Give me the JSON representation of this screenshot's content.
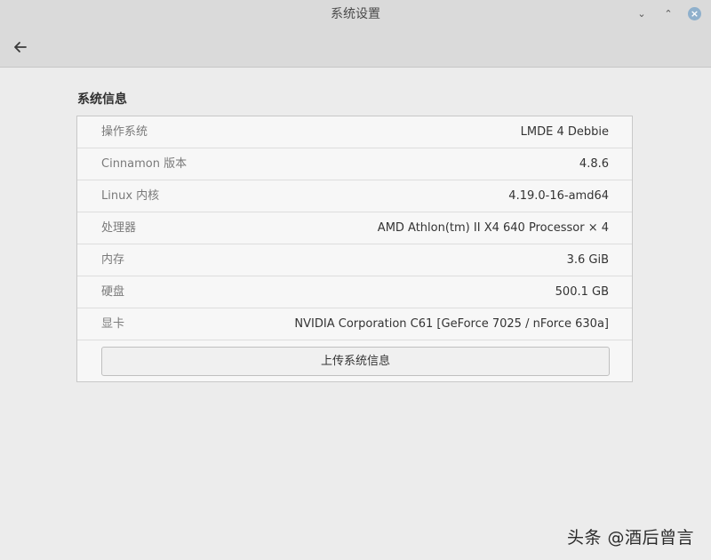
{
  "window": {
    "title": "系统设置",
    "minimize_glyph": "⌄",
    "maximize_glyph": "⌃",
    "close_glyph": "×"
  },
  "toolbar": {
    "back_icon": "back-arrow-icon"
  },
  "section": {
    "title": "系统信息"
  },
  "info": {
    "rows": [
      {
        "label": "操作系统",
        "value": "LMDE 4 Debbie"
      },
      {
        "label": "Cinnamon 版本",
        "value": "4.8.6"
      },
      {
        "label": "Linux 内核",
        "value": "4.19.0-16-amd64"
      },
      {
        "label": "处理器",
        "value": "AMD Athlon(tm) II X4 640 Processor × 4"
      },
      {
        "label": "内存",
        "value": "3.6 GiB"
      },
      {
        "label": "硬盘",
        "value": "500.1 GB"
      },
      {
        "label": "显卡",
        "value": "NVIDIA Corporation C61 [GeForce 7025 / nForce 630a]"
      }
    ]
  },
  "actions": {
    "upload_label": "上传系统信息"
  },
  "watermark": {
    "text": "头条 @酒后曾言"
  },
  "colors": {
    "background": "#ececec",
    "titlebar": "#dadada",
    "panel": "#f7f7f7",
    "close_button": "#8fb0cc"
  }
}
